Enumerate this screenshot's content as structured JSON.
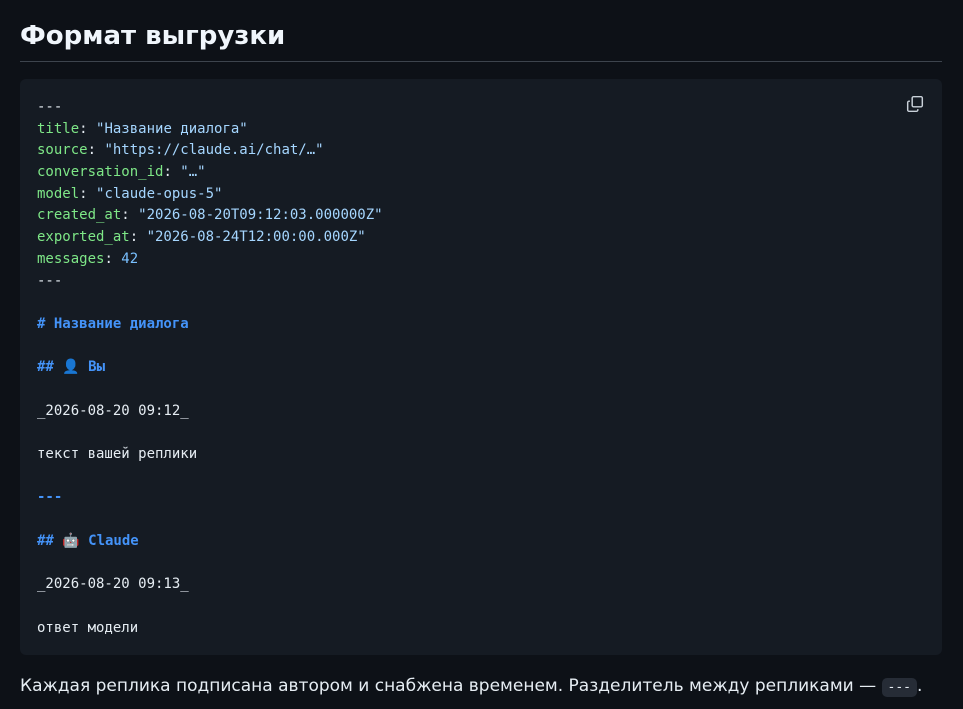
{
  "section": {
    "title": "Формат выгрузки"
  },
  "code_block": {
    "copy_icon": "copy-icon",
    "frontmatter": {
      "open": "---",
      "fields": [
        {
          "key": "title",
          "sep": ": ",
          "value": "\"Название диалога\"",
          "kind": "str"
        },
        {
          "key": "source",
          "sep": ": ",
          "value": "\"https://claude.ai/chat/…\"",
          "kind": "str"
        },
        {
          "key": "conversation_id",
          "sep": ": ",
          "value": "\"…\"",
          "kind": "str"
        },
        {
          "key": "model",
          "sep": ": ",
          "value": "\"claude-opus-5\"",
          "kind": "str"
        },
        {
          "key": "created_at",
          "sep": ": ",
          "value": "\"2026-08-20T09:12:03.000000Z\"",
          "kind": "str"
        },
        {
          "key": "exported_at",
          "sep": ": ",
          "value": "\"2026-08-24T12:00:00.000Z\"",
          "kind": "str"
        },
        {
          "key": "messages",
          "sep": ": ",
          "value": "42",
          "kind": "num"
        }
      ],
      "close": "---"
    },
    "body": {
      "h1": "# Название диалога",
      "user_heading": "## 👤 Вы",
      "user_time": "_2026-08-20 09:12_",
      "user_text": "текст вашей реплики",
      "separator": "---",
      "assistant_heading": "## 🤖 Claude",
      "assistant_time": "_2026-08-20 09:13_",
      "assistant_text": "ответ модели"
    }
  },
  "footer": {
    "text": "Каждая реплика подписана автором и снабжена временем. Разделитель между репликами — ",
    "code": "---",
    "end": "."
  }
}
